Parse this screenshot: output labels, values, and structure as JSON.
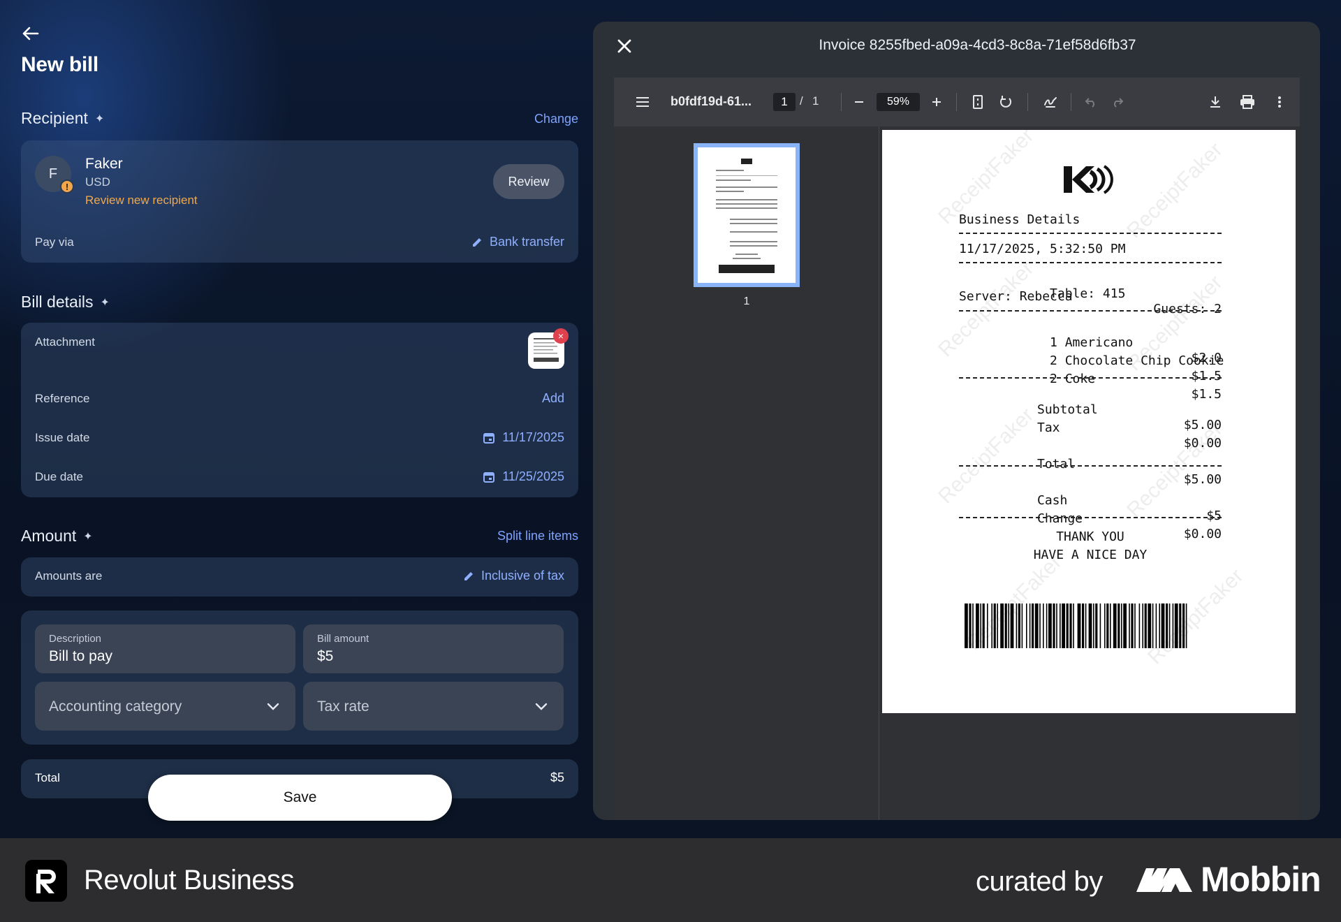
{
  "page": {
    "title": "New bill"
  },
  "recipient": {
    "heading": "Recipient",
    "change_label": "Change",
    "initial": "F",
    "name": "Faker",
    "currency": "USD",
    "review_note": "Review new recipient",
    "review_button": "Review",
    "pay_via_label": "Pay via",
    "pay_via_value": "Bank transfer"
  },
  "bill_details": {
    "heading": "Bill details",
    "attachment_label": "Attachment",
    "reference_label": "Reference",
    "reference_action": "Add",
    "issue_date_label": "Issue date",
    "issue_date_value": "11/17/2025",
    "due_date_label": "Due date",
    "due_date_value": "11/25/2025"
  },
  "amount": {
    "heading": "Amount",
    "split_label": "Split line items",
    "amounts_are_label": "Amounts are",
    "amounts_are_value": "Inclusive of tax",
    "description_label": "Description",
    "description_value": "Bill to pay",
    "bill_amount_label": "Bill amount",
    "bill_amount_value": "$5",
    "accounting_placeholder": "Accounting category",
    "tax_placeholder": "Tax rate",
    "total_label": "Total",
    "total_value": "$5",
    "save_label": "Save"
  },
  "viewer": {
    "title": "Invoice 8255fbed-a09a-4cd3-8c8a-71ef58d6fb37",
    "file_name": "b0fdf19d-61...",
    "page_current": "1",
    "page_sep": "/",
    "page_total": "1",
    "zoom": "59%",
    "thumb_number": "1"
  },
  "receipt": {
    "business": "Business Details",
    "datetime": "11/17/2025, 5:32:50 PM",
    "table": "Table: 415",
    "guests": "Guests: 2",
    "server": "Server: Rebecca",
    "items": [
      {
        "name": "1 Americano",
        "price": "$2.0"
      },
      {
        "name": "2 Chocolate Chip Cookie",
        "price": "$1.5"
      },
      {
        "name": "2 Coke",
        "price": "$1.5"
      }
    ],
    "subtotal_label": "Subtotal",
    "subtotal_value": "$5.00",
    "tax_label": "Tax",
    "tax_value": "$0.00",
    "total_label": "Total",
    "total_value": "$5.00",
    "cash_label": "Cash",
    "cash_value": "$5",
    "change_label": "Change",
    "change_value": "$0.00",
    "thanks": "THANK YOU",
    "nice_day": "HAVE A NICE DAY",
    "watermark": "ReceiptFaker"
  },
  "footer": {
    "brand": "Revolut Business",
    "curated": "curated by",
    "mobbin": "Mobbin"
  },
  "colors": {
    "accent": "#7fa3ff",
    "warning": "#f2a84a",
    "remove": "#e0414f",
    "thumb_border": "#8ab4f8"
  }
}
